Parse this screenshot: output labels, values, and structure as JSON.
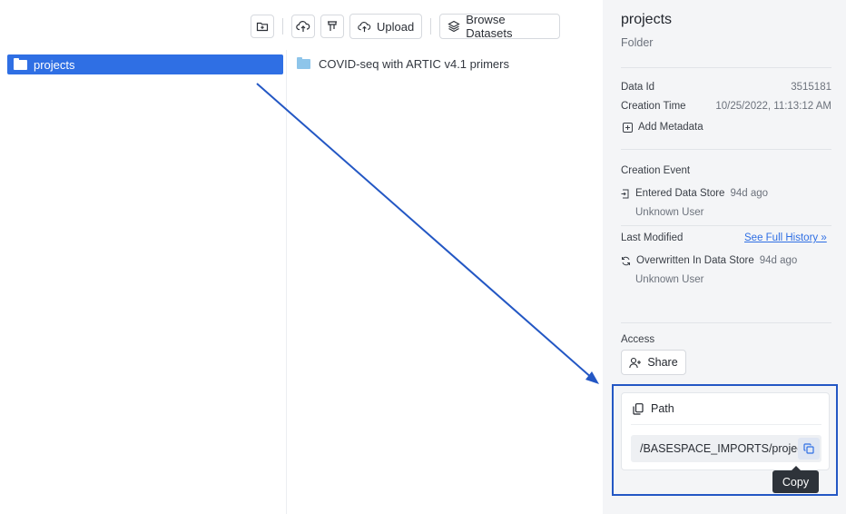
{
  "toolbar": {
    "new_folder_icon": "folder-plus-icon",
    "cloud_icon": "cloud-upload-icon",
    "filter_icon": "filter-icon",
    "upload_label": "Upload",
    "browse_label": "Browse Datasets"
  },
  "tree": {
    "selected_item": "projects",
    "folder_color": "#ffffff"
  },
  "browser": {
    "items": [
      {
        "label": "COVID-seq with ARTIC v4.1 primers",
        "folder_color": "#8ec5ea"
      }
    ]
  },
  "panel": {
    "title": "projects",
    "subtitle": "Folder",
    "data_id_label": "Data Id",
    "data_id_value": "3515181",
    "creation_time_label": "Creation Time",
    "creation_time_value": "10/25/2022, 11:13:12 AM",
    "add_metadata_label": "Add Metadata",
    "creation_event_heading": "Creation Event",
    "creation_event_text": "Entered Data Store",
    "creation_event_age": "94d ago",
    "creation_event_user": "Unknown User",
    "last_modified_heading": "Last Modified",
    "full_history_link": "See Full History »",
    "modified_event_text": "Overwritten In Data Store",
    "modified_event_age": "94d ago",
    "modified_event_user": "Unknown User",
    "access_heading": "Access",
    "share_label": "Share",
    "path_heading": "Path",
    "path_value": "/BASESPACE_IMPORTS/projects",
    "copy_tooltip": "Copy"
  },
  "colors": {
    "accent": "#2f6fe4",
    "annotation": "#2357c4"
  }
}
